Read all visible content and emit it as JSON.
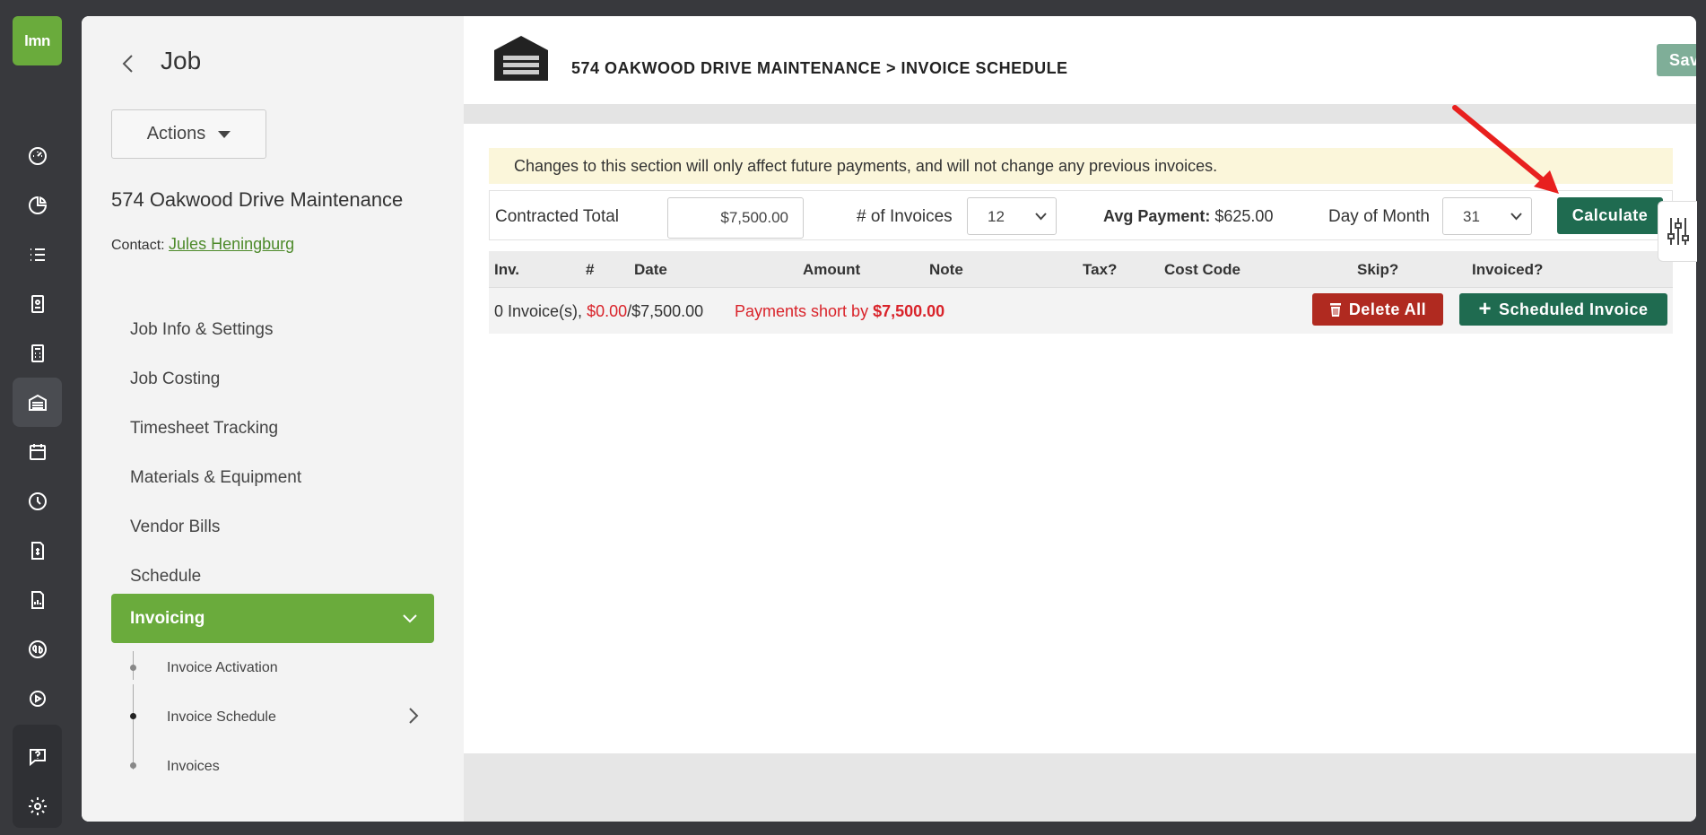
{
  "app": {
    "logo_text": "lmn"
  },
  "rail": {
    "icons": [
      "dashboard-icon",
      "pie-chart-icon",
      "list-icon",
      "contacts-icon",
      "calculator-icon",
      "jobs-garage-icon",
      "calendar-icon",
      "clock-icon",
      "invoice-icon",
      "report-icon",
      "quickbooks-icon",
      "play-icon",
      "help-icon",
      "gear-icon"
    ],
    "active": "jobs-garage-icon"
  },
  "nav": {
    "title": "Job",
    "actions_label": "Actions",
    "job_name": "574 Oakwood Drive Maintenance",
    "contact_label": "Contact:",
    "contact_name": "Jules Heningburg",
    "items": [
      {
        "label": "Job Info & Settings"
      },
      {
        "label": "Job Costing"
      },
      {
        "label": "Timesheet Tracking"
      },
      {
        "label": "Materials & Equipment"
      },
      {
        "label": "Vendor Bills"
      },
      {
        "label": "Schedule"
      }
    ],
    "active_item": "Invoicing",
    "sub_items": [
      {
        "label": "Invoice Activation"
      },
      {
        "label": "Invoice Schedule"
      },
      {
        "label": "Invoices"
      }
    ]
  },
  "header": {
    "breadcrumb": "574 OAKWOOD DRIVE MAINTENANCE > INVOICE SCHEDULE",
    "save_label": "Save"
  },
  "notice": "Changes to this section will only affect future payments, and will not change any previous invoices.",
  "form": {
    "contracted_total_label": "Contracted Total",
    "contracted_total_value": "$7,500.00",
    "num_invoices_label": "# of Invoices",
    "num_invoices_value": "12",
    "avg_payment_label": "Avg Payment:",
    "avg_payment_value": "$625.00",
    "day_of_month_label": "Day of Month",
    "day_of_month_value": "31",
    "calculate_label": "Calculate"
  },
  "table": {
    "columns": [
      "Inv.",
      "#",
      "Date",
      "Amount",
      "Note",
      "Tax?",
      "Cost Code",
      "Skip?",
      "Invoiced?"
    ],
    "summary_count": "0 Invoice(s),",
    "summary_paid": "$0.00",
    "summary_total": "/$7,500.00",
    "short_label": "Payments short by",
    "short_value": "$7,500.00",
    "delete_all_label": "Delete All",
    "scheduled_invoice_label": "Scheduled Invoice"
  },
  "colors": {
    "brand_green": "#6aab3c",
    "dark_green": "#1f6b50",
    "danger_red": "#b02a20",
    "alert_red": "#d9232a",
    "rail_bg": "#38393d"
  }
}
